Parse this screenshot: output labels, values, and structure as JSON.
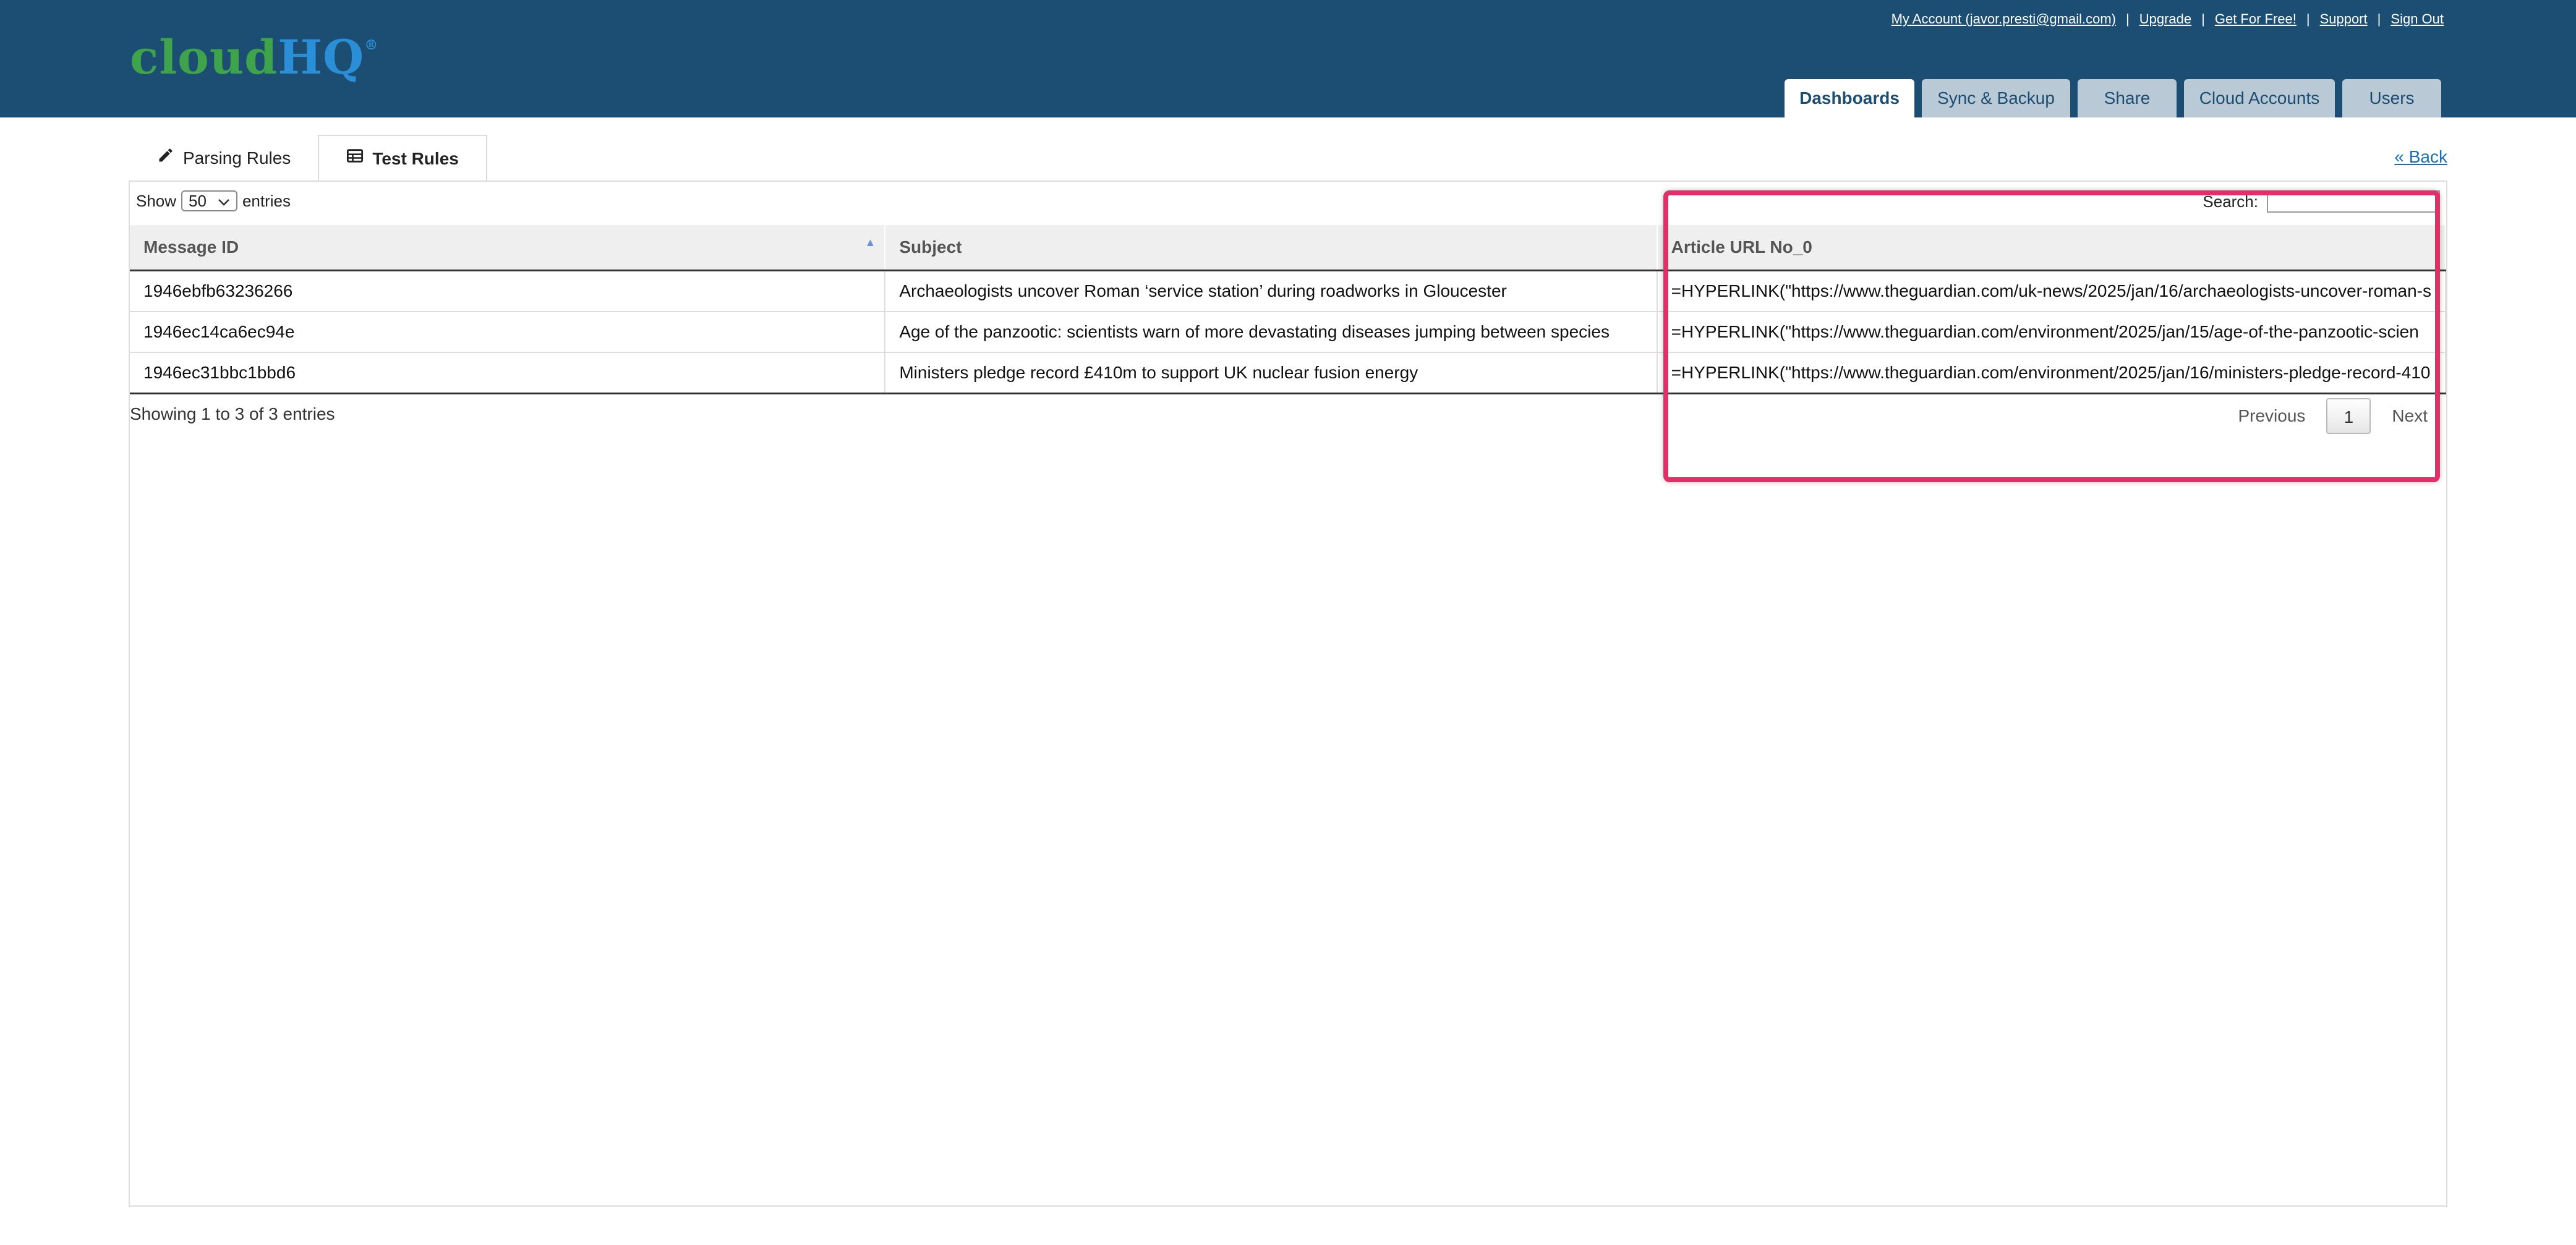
{
  "brand": {
    "part1": "cloud",
    "part2": "HQ",
    "reg": "®"
  },
  "toplinks": [
    "My Account (javor.presti@gmail.com)",
    "Upgrade",
    "Get For Free!",
    "Support",
    "Sign Out"
  ],
  "separator": "|",
  "nav": [
    "Dashboards",
    "Sync & Backup",
    "Share",
    "Cloud Accounts",
    "Users"
  ],
  "subtabs": {
    "parsing": "Parsing Rules",
    "test": "Test Rules"
  },
  "back_label": "« Back",
  "table_controls": {
    "show_label": "Show",
    "page_size": "50",
    "entries_label": "entries",
    "search_label": "Search:"
  },
  "columns": [
    "Message ID",
    "Subject",
    "Article URL No_0"
  ],
  "rows": [
    {
      "id": "1946ebfb63236266",
      "subject": "Archaeologists uncover Roman ‘service station’ during roadworks in Gloucester",
      "url": "=HYPERLINK(\"https://www.theguardian.com/uk-news/2025/jan/16/archaeologists-uncover-roman-s"
    },
    {
      "id": "1946ec14ca6ec94e",
      "subject": "Age of the panzootic: scientists warn of more devastating diseases jumping between species",
      "url": "=HYPERLINK(\"https://www.theguardian.com/environment/2025/jan/15/age-of-the-panzootic-scien"
    },
    {
      "id": "1946ec31bbc1bbd6",
      "subject": "Ministers pledge record £410m to support UK nuclear fusion energy",
      "url": "=HYPERLINK(\"https://www.theguardian.com/environment/2025/jan/16/ministers-pledge-record-410"
    }
  ],
  "info": "Showing 1 to 3 of 3 entries",
  "pager": {
    "previous": "Previous",
    "page": "1",
    "next": "Next"
  },
  "colors": {
    "header": "#1b4e72",
    "highlight": "#e0306a",
    "link": "#1a6fb0"
  }
}
